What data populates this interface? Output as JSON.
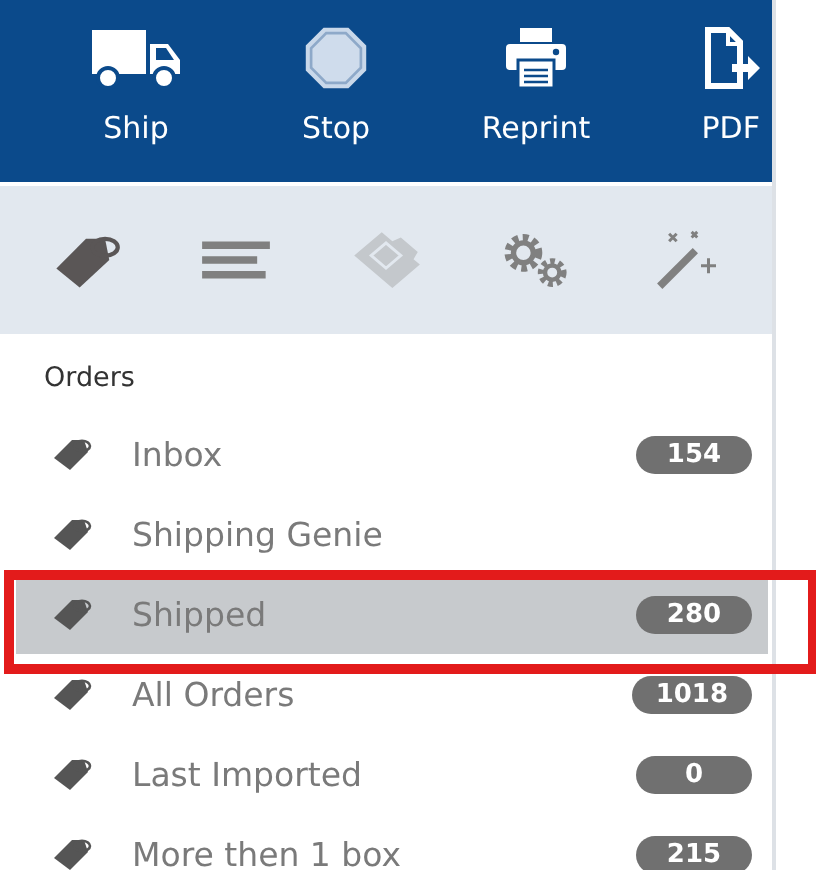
{
  "toolbar": [
    {
      "kind": "truck",
      "label": "Ship"
    },
    {
      "kind": "stop",
      "label": "Stop"
    },
    {
      "kind": "printer",
      "label": "Reprint"
    },
    {
      "kind": "pdf",
      "label": "PDF"
    }
  ],
  "tabs": [
    {
      "kind": "tag",
      "selected": true,
      "disabled": false
    },
    {
      "kind": "lines",
      "selected": false,
      "disabled": false
    },
    {
      "kind": "ticket",
      "selected": false,
      "disabled": true
    },
    {
      "kind": "gears",
      "selected": false,
      "disabled": false
    },
    {
      "kind": "wand",
      "selected": false,
      "disabled": false
    }
  ],
  "section": {
    "title": "Orders"
  },
  "items": [
    {
      "label": "Inbox",
      "count": "154",
      "selected": false,
      "annotated": false
    },
    {
      "label": "Shipping Genie",
      "selected": false,
      "annotated": false
    },
    {
      "label": "Shipped",
      "count": "280",
      "selected": true,
      "annotated": true
    },
    {
      "label": "All Orders",
      "count": "1018",
      "selected": false,
      "annotated": false
    },
    {
      "label": "Last Imported",
      "count": "0",
      "selected": false,
      "annotated": false
    },
    {
      "label": "More then 1 box",
      "count": "215",
      "selected": false,
      "annotated": false
    }
  ]
}
